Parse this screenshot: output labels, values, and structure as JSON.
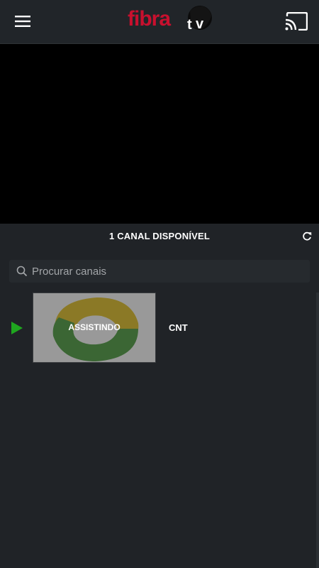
{
  "header": {
    "menu_icon": "hamburger-menu-icon",
    "logo_text": "fibra tv",
    "cast_icon": "cast-icon",
    "brand_color": "#c8102e"
  },
  "player": {
    "background": "#000000"
  },
  "channels": {
    "count_label": "1 CANAL DISPONÍVEL",
    "refresh_icon": "refresh-icon"
  },
  "search": {
    "placeholder": "Procurar canais",
    "value": ""
  },
  "list": [
    {
      "name": "CNT",
      "status": "ASSISTINDO",
      "playing": true,
      "indicator_color": "#1fa61f"
    }
  ]
}
